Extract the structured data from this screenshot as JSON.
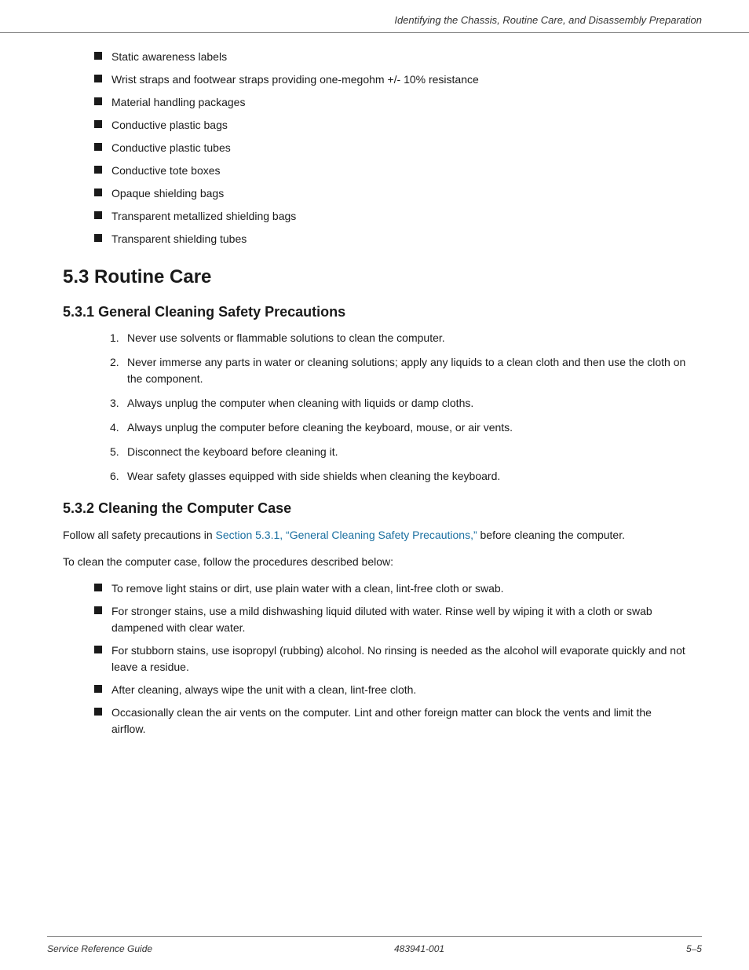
{
  "header": {
    "title": "Identifying the Chassis, Routine Care, and Disassembly Preparation"
  },
  "bullet_list": [
    "Static awareness labels",
    "Wrist straps and footwear straps providing one-megohm +/- 10% resistance",
    "Material handling packages",
    "Conductive plastic bags",
    "Conductive plastic tubes",
    "Conductive tote boxes",
    "Opaque shielding bags",
    "Transparent metallized shielding bags",
    "Transparent shielding tubes"
  ],
  "section_5_3": {
    "label": "5.3",
    "title": "Routine Care"
  },
  "section_5_3_1": {
    "label": "5.3.1",
    "title": "General Cleaning Safety Precautions"
  },
  "cleaning_steps": [
    "Never use solvents or flammable solutions to clean the computer.",
    "Never immerse any parts in water or cleaning solutions; apply any liquids to a clean cloth and then use the cloth on the component.",
    "Always unplug the computer when cleaning with liquids or damp cloths.",
    "Always unplug the computer before cleaning the keyboard, mouse, or air vents.",
    "Disconnect the keyboard before cleaning it.",
    "Wear safety glasses equipped with side shields when cleaning the keyboard."
  ],
  "section_5_3_2": {
    "label": "5.3.2",
    "title": "Cleaning the Computer Case"
  },
  "computer_case_para1_prefix": "Follow all safety precautions in ",
  "computer_case_para1_link": "Section 5.3.1, “General Cleaning Safety Precautions,”",
  "computer_case_para1_suffix": " before cleaning the computer.",
  "computer_case_para2": "To clean the computer case, follow the procedures described below:",
  "case_bullets": [
    "To remove light stains or dirt, use plain water with a clean, lint-free cloth or swab.",
    "For stronger stains, use a mild dishwashing liquid diluted with water. Rinse well by wiping it with a cloth or swab dampened with clear water.",
    "For stubborn stains, use isopropyl (rubbing) alcohol. No rinsing is needed as the alcohol will evaporate quickly and not leave a residue.",
    "After cleaning, always wipe the unit with a clean, lint-free cloth.",
    "Occasionally clean the air vents on the computer. Lint and other foreign matter can block the vents and limit the airflow."
  ],
  "footer": {
    "left": "Service Reference Guide",
    "center": "483941-001",
    "right": "5–5"
  }
}
